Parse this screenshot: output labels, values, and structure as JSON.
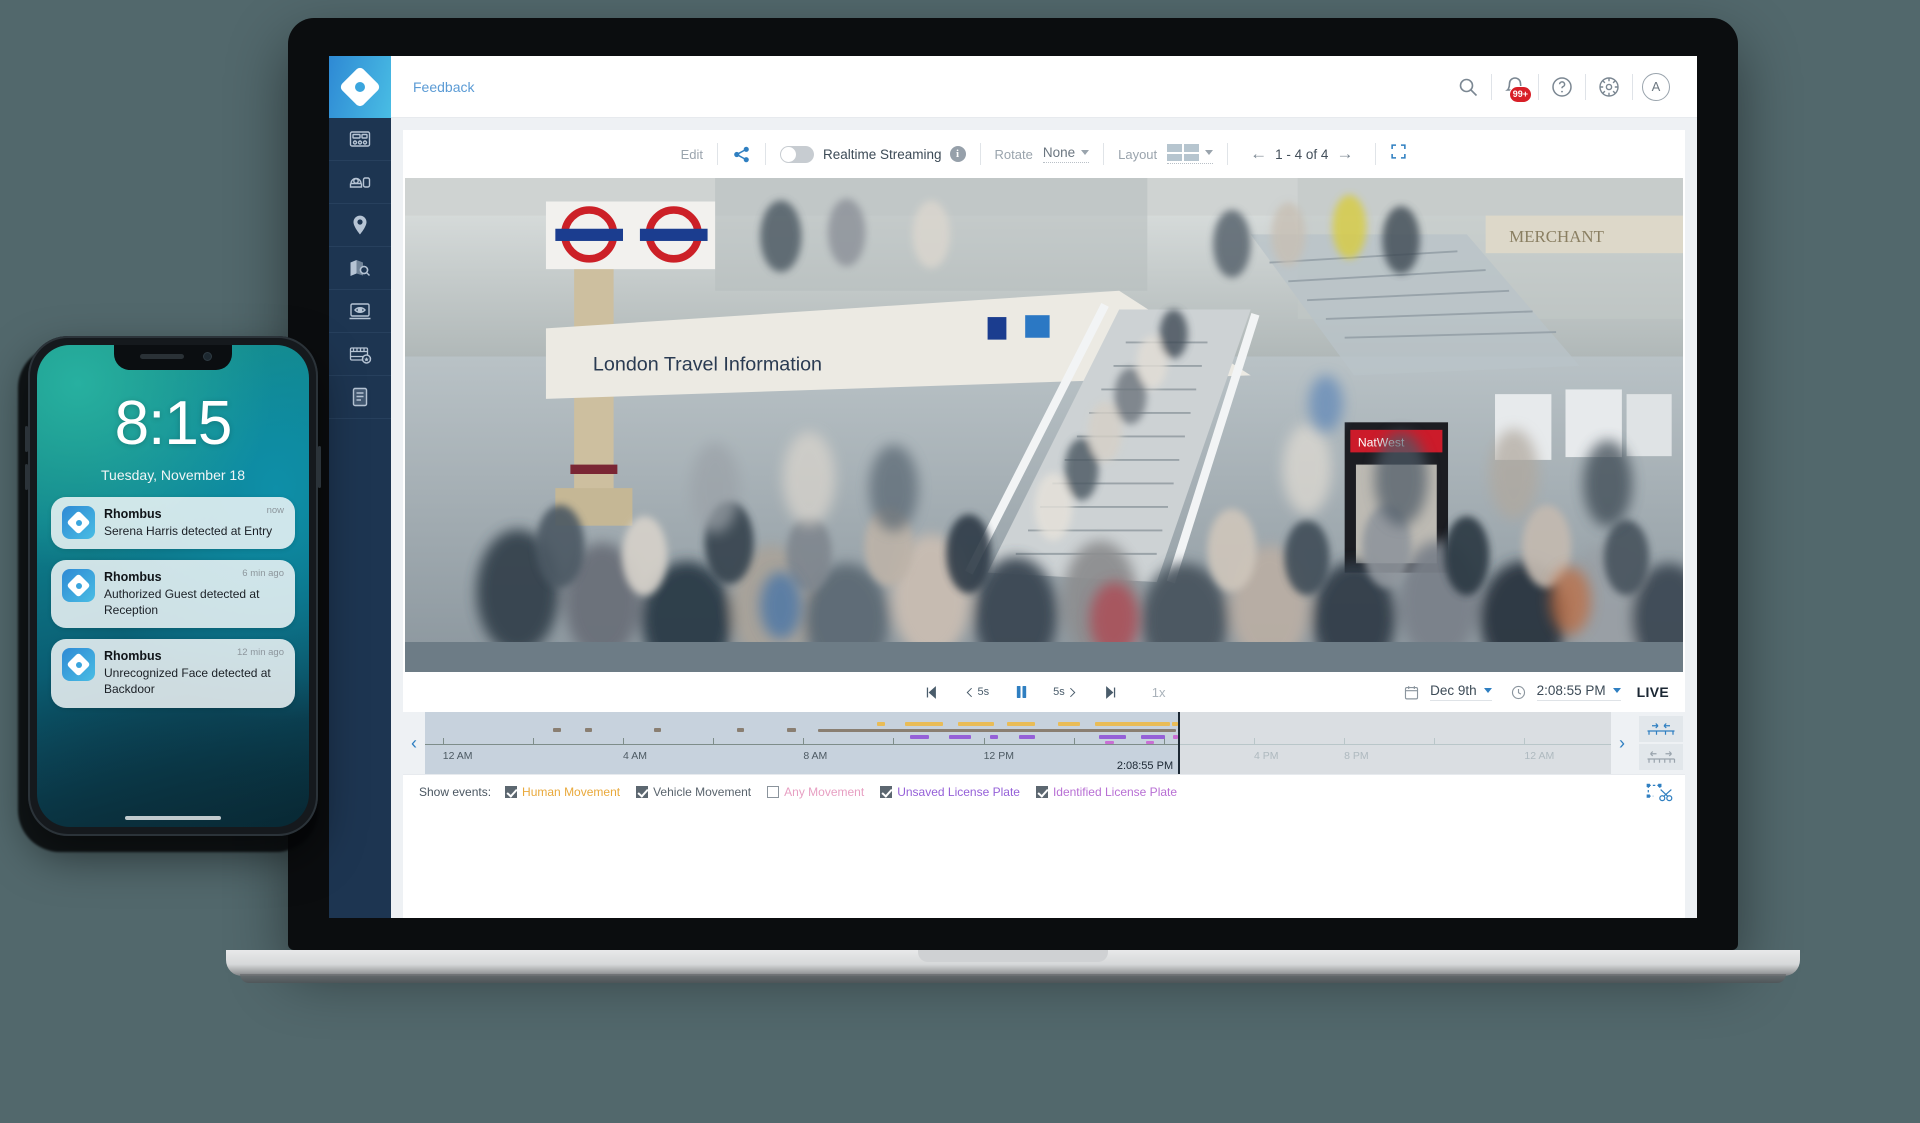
{
  "app": {
    "brand": "Rhombus",
    "logo_icon": "rhombus-diamond-logo",
    "header": {
      "feedback_label": "Feedback",
      "icons": [
        {
          "name": "search-icon",
          "label": "Search"
        },
        {
          "name": "bell-icon",
          "label": "Notifications",
          "badge": "99+"
        },
        {
          "name": "help-icon",
          "label": "Help"
        },
        {
          "name": "gear-icon",
          "label": "Settings"
        },
        {
          "name": "avatar",
          "label": "A"
        }
      ]
    },
    "sidebar": {
      "items": [
        {
          "name": "sidebar-item-dashboard",
          "icon": "dashboard-icon"
        },
        {
          "name": "sidebar-item-cameras",
          "icon": "camera-icon"
        },
        {
          "name": "sidebar-item-locations",
          "icon": "map-pin-icon"
        },
        {
          "name": "sidebar-item-floorplan",
          "icon": "map-search-icon"
        },
        {
          "name": "sidebar-item-media",
          "icon": "monitor-eye-icon"
        },
        {
          "name": "sidebar-item-clips",
          "icon": "film-star-icon"
        },
        {
          "name": "sidebar-item-reports",
          "icon": "document-icon"
        }
      ]
    },
    "toolbar": {
      "edit_label": "Edit",
      "share_icon": "share-icon",
      "streaming_toggle_on": false,
      "streaming_label": "Realtime Streaming",
      "info_icon": "info-icon",
      "rotate_label": "Rotate",
      "rotate_value": "None",
      "layout_label": "Layout",
      "layout_icon": "grid-layout-icon",
      "prev_icon": "arrow-left-icon",
      "next_icon": "arrow-right-icon",
      "pager_text": "1 - 4 of 4",
      "fullscreen_icon": "fullscreen-icon"
    },
    "playback": {
      "skip_start_icon": "skip-to-start-icon",
      "back_label": "5s",
      "pause_icon": "pause-icon",
      "forward_label": "5s",
      "skip_end_icon": "skip-to-end-icon",
      "speed": "1x",
      "calendar_icon": "calendar-icon",
      "date_value": "Dec 9th",
      "clock_icon": "clock-icon",
      "time_value": "2:08:55 PM",
      "live_label": "LIVE"
    },
    "timeline": {
      "prev_day_icon": "chevron-left-icon",
      "next_day_icon": "chevron-right-icon",
      "playhead_time": "2:08:55 PM",
      "tick_labels": [
        "12 AM",
        "4 AM",
        "8 AM",
        "12 PM",
        "4 PM",
        "8 PM",
        "12 AM"
      ],
      "tools": [
        {
          "name": "timeline-zoom-in-button",
          "icon": "zoom-in-timeline-icon"
        },
        {
          "name": "timeline-zoom-out-button",
          "icon": "zoom-out-timeline-icon"
        }
      ],
      "clip_tool_icon": "scissors-clip-icon"
    },
    "events": {
      "title": "Show events:",
      "filters": [
        {
          "label": "Human Movement",
          "checked": true,
          "color": "#e9a93b"
        },
        {
          "label": "Vehicle Movement",
          "checked": true,
          "color": "#8a949c"
        },
        {
          "label": "Any Movement",
          "checked": false,
          "color": "#e79fc2"
        },
        {
          "label": "Unsaved License Plate",
          "checked": true,
          "color": "#9560d8"
        },
        {
          "label": "Identified License Plate",
          "checked": true,
          "color": "#c96fd4"
        }
      ],
      "clip_icon": "scissors-clip-icon"
    },
    "colors": {
      "brand_blue": "#2f7fc1",
      "sidebar_navy": "#1d3551",
      "accent_cyan": "#49bde4",
      "badge_red": "#d81f27"
    }
  },
  "phone": {
    "time": "8:15",
    "date": "Tuesday, November 18",
    "notifications": [
      {
        "app": "Rhombus",
        "message": "Serena Harris detected at Entry",
        "time": "now"
      },
      {
        "app": "Rhombus",
        "message": "Authorized Guest detected at Reception",
        "time": "6 min ago"
      },
      {
        "app": "Rhombus",
        "message": "Unrecognized Face detected at Backdoor",
        "time": "12 min ago"
      }
    ]
  },
  "video": {
    "scene_description": "London Underground station concourse with crowds and escalators",
    "signage": [
      "London Travel Information",
      "UNDERGROUND",
      "NatWest",
      "MERCHANT"
    ]
  }
}
